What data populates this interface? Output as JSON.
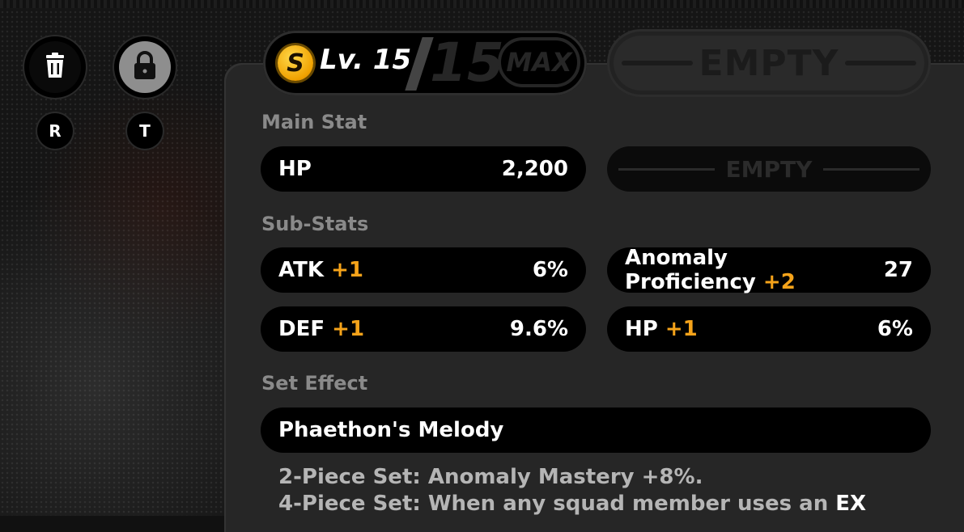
{
  "side_buttons": [
    {
      "name": "delete",
      "icon": "trash-icon",
      "key": "R"
    },
    {
      "name": "lock",
      "icon": "lock-icon",
      "key": "T"
    }
  ],
  "level": {
    "coin_letter": "S",
    "label": "Lv. 15",
    "max_level": "15",
    "max_badge": "MAX"
  },
  "empty_top": "EMPTY",
  "main_stat": {
    "heading": "Main Stat",
    "name": "HP",
    "value": "2,200",
    "empty_label": "EMPTY"
  },
  "sub_stats": {
    "heading": "Sub-Stats",
    "items": [
      {
        "name": "ATK",
        "bonus": "+1",
        "value": "6%"
      },
      {
        "name": "Anomaly",
        "name2": "Proficiency",
        "bonus": "+2",
        "value": "27"
      },
      {
        "name": "DEF",
        "bonus": "+1",
        "value": "9.6%"
      },
      {
        "name": "HP",
        "bonus": "+1",
        "value": "6%"
      }
    ]
  },
  "set_effect": {
    "heading": "Set Effect",
    "name": "Phaethon's Melody",
    "line1": "2-Piece Set: Anomaly Mastery +8%.",
    "line2": "4-Piece Set: When any squad member uses an",
    "line2_highlight": "EX"
  },
  "colors": {
    "accent": "#f5a31a",
    "panel": "#262626",
    "pill": "#000000"
  }
}
